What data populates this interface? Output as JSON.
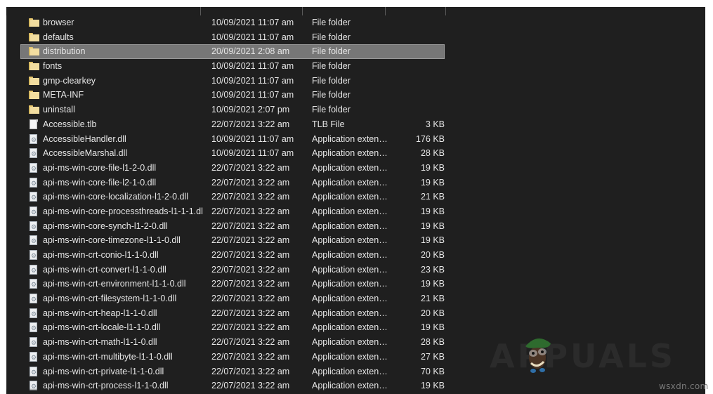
{
  "window": {
    "background_color": "#1f1f1f",
    "selection_color": "#777777",
    "text_color": "#e6e6e6"
  },
  "columns": {
    "separator_positions": [
      276,
      421,
      539,
      625
    ]
  },
  "watermark": {
    "text": "APPUALS",
    "credit": "wsxdn.com"
  },
  "files": [
    {
      "icon": "folder-icon",
      "name": "browser",
      "date": "10/09/2021 11:07 am",
      "type": "File folder",
      "size": "",
      "selected": false
    },
    {
      "icon": "folder-icon",
      "name": "defaults",
      "date": "10/09/2021 11:07 am",
      "type": "File folder",
      "size": "",
      "selected": false
    },
    {
      "icon": "folder-icon",
      "name": "distribution",
      "date": "20/09/2021 2:08 am",
      "type": "File folder",
      "size": "",
      "selected": true
    },
    {
      "icon": "folder-icon",
      "name": "fonts",
      "date": "10/09/2021 11:07 am",
      "type": "File folder",
      "size": "",
      "selected": false
    },
    {
      "icon": "folder-icon",
      "name": "gmp-clearkey",
      "date": "10/09/2021 11:07 am",
      "type": "File folder",
      "size": "",
      "selected": false
    },
    {
      "icon": "folder-icon",
      "name": "META-INF",
      "date": "10/09/2021 11:07 am",
      "type": "File folder",
      "size": "",
      "selected": false
    },
    {
      "icon": "folder-icon",
      "name": "uninstall",
      "date": "10/09/2021 2:07 pm",
      "type": "File folder",
      "size": "",
      "selected": false
    },
    {
      "icon": "document-icon",
      "name": "Accessible.tlb",
      "date": "22/07/2021 3:22 am",
      "type": "TLB File",
      "size": "3 KB",
      "selected": false
    },
    {
      "icon": "dll-icon",
      "name": "AccessibleHandler.dll",
      "date": "10/09/2021 11:07 am",
      "type": "Application exten…",
      "size": "176 KB",
      "selected": false
    },
    {
      "icon": "dll-icon",
      "name": "AccessibleMarshal.dll",
      "date": "10/09/2021 11:07 am",
      "type": "Application exten…",
      "size": "28 KB",
      "selected": false
    },
    {
      "icon": "dll-icon",
      "name": "api-ms-win-core-file-l1-2-0.dll",
      "date": "22/07/2021 3:22 am",
      "type": "Application exten…",
      "size": "19 KB",
      "selected": false
    },
    {
      "icon": "dll-icon",
      "name": "api-ms-win-core-file-l2-1-0.dll",
      "date": "22/07/2021 3:22 am",
      "type": "Application exten…",
      "size": "19 KB",
      "selected": false
    },
    {
      "icon": "dll-icon",
      "name": "api-ms-win-core-localization-l1-2-0.dll",
      "date": "22/07/2021 3:22 am",
      "type": "Application exten…",
      "size": "21 KB",
      "selected": false
    },
    {
      "icon": "dll-icon",
      "name": "api-ms-win-core-processthreads-l1-1-1.dll",
      "date": "22/07/2021 3:22 am",
      "type": "Application exten…",
      "size": "19 KB",
      "selected": false
    },
    {
      "icon": "dll-icon",
      "name": "api-ms-win-core-synch-l1-2-0.dll",
      "date": "22/07/2021 3:22 am",
      "type": "Application exten…",
      "size": "19 KB",
      "selected": false
    },
    {
      "icon": "dll-icon",
      "name": "api-ms-win-core-timezone-l1-1-0.dll",
      "date": "22/07/2021 3:22 am",
      "type": "Application exten…",
      "size": "19 KB",
      "selected": false
    },
    {
      "icon": "dll-icon",
      "name": "api-ms-win-crt-conio-l1-1-0.dll",
      "date": "22/07/2021 3:22 am",
      "type": "Application exten…",
      "size": "20 KB",
      "selected": false
    },
    {
      "icon": "dll-icon",
      "name": "api-ms-win-crt-convert-l1-1-0.dll",
      "date": "22/07/2021 3:22 am",
      "type": "Application exten…",
      "size": "23 KB",
      "selected": false
    },
    {
      "icon": "dll-icon",
      "name": "api-ms-win-crt-environment-l1-1-0.dll",
      "date": "22/07/2021 3:22 am",
      "type": "Application exten…",
      "size": "19 KB",
      "selected": false
    },
    {
      "icon": "dll-icon",
      "name": "api-ms-win-crt-filesystem-l1-1-0.dll",
      "date": "22/07/2021 3:22 am",
      "type": "Application exten…",
      "size": "21 KB",
      "selected": false
    },
    {
      "icon": "dll-icon",
      "name": "api-ms-win-crt-heap-l1-1-0.dll",
      "date": "22/07/2021 3:22 am",
      "type": "Application exten…",
      "size": "20 KB",
      "selected": false
    },
    {
      "icon": "dll-icon",
      "name": "api-ms-win-crt-locale-l1-1-0.dll",
      "date": "22/07/2021 3:22 am",
      "type": "Application exten…",
      "size": "19 KB",
      "selected": false
    },
    {
      "icon": "dll-icon",
      "name": "api-ms-win-crt-math-l1-1-0.dll",
      "date": "22/07/2021 3:22 am",
      "type": "Application exten…",
      "size": "28 KB",
      "selected": false
    },
    {
      "icon": "dll-icon",
      "name": "api-ms-win-crt-multibyte-l1-1-0.dll",
      "date": "22/07/2021 3:22 am",
      "type": "Application exten…",
      "size": "27 KB",
      "selected": false
    },
    {
      "icon": "dll-icon",
      "name": "api-ms-win-crt-private-l1-1-0.dll",
      "date": "22/07/2021 3:22 am",
      "type": "Application exten…",
      "size": "70 KB",
      "selected": false
    },
    {
      "icon": "dll-icon",
      "name": "api-ms-win-crt-process-l1-1-0.dll",
      "date": "22/07/2021 3:22 am",
      "type": "Application exten…",
      "size": "19 KB",
      "selected": false
    }
  ]
}
